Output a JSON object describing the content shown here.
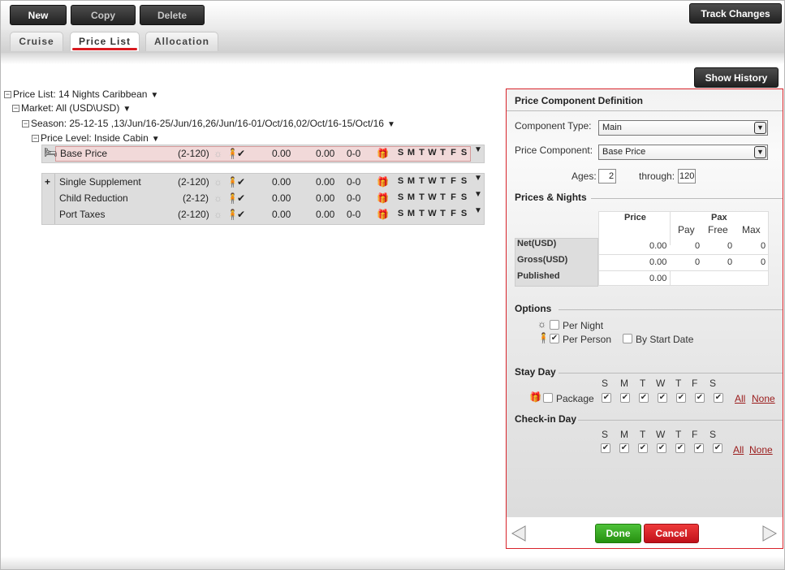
{
  "toolbar": {
    "new": "New",
    "copy": "Copy",
    "delete": "Delete",
    "track": "Track Changes"
  },
  "tabs": [
    "Cruise",
    "Price List",
    "Allocation"
  ],
  "show_history": "Show History",
  "tree": {
    "price_list": "Price List: 14 Nights Caribbean",
    "market": "Market: All (USD\\USD)",
    "season": "Season: 25-12-15 ,13/Jun/16-25/Jun/16,26/Jun/16-01/Oct/16,02/Oct/16-15/Oct/16",
    "price_level": "Price Level: Inside Cabin"
  },
  "base_row": {
    "name": "Base Price",
    "ages": "(2-120)",
    "v1": "0.00",
    "v2": "0.00",
    "v3": "0-0"
  },
  "rows": [
    {
      "name": "Single Supplement",
      "ages": "(2-120)",
      "v1": "0.00",
      "v2": "0.00",
      "v3": "0-0"
    },
    {
      "name": "Child Reduction",
      "ages": "(2-12)",
      "v1": "0.00",
      "v2": "0.00",
      "v3": "0-0"
    },
    {
      "name": "Port Taxes",
      "ages": "(2-120)",
      "v1": "0.00",
      "v2": "0.00",
      "v3": "0-0"
    }
  ],
  "day_letters": [
    "S",
    "M",
    "T",
    "W",
    "T",
    "F",
    "S"
  ],
  "panel": {
    "title": "Price Component Definition",
    "component_type_label": "Component Type:",
    "component_type_value": "Main",
    "price_component_label": "Price Component:",
    "price_component_value": "Base Price",
    "ages_label": "Ages:",
    "ages_from": "2",
    "through_label": "through:",
    "ages_to": "120",
    "prices_nights": "Prices & Nights",
    "col_price": "Price",
    "col_pax": "Pax",
    "col_pay": "Pay",
    "col_free": "Free",
    "col_max": "Max",
    "net_label": "Net(USD)",
    "net": {
      "price": "0.00",
      "pay": "0",
      "free": "0",
      "max": "0"
    },
    "gross_label": "Gross(USD)",
    "gross": {
      "price": "0.00",
      "pay": "0",
      "free": "0",
      "max": "0"
    },
    "published_label": "Published",
    "published": "0.00",
    "options": "Options",
    "per_night": "Per Night",
    "per_person": "Per Person",
    "by_start_date": "By Start Date",
    "stay_day": "Stay Day",
    "package": "Package",
    "all": "All",
    "none": "None",
    "checkin_day": "Check-in Day",
    "done": "Done",
    "cancel": "Cancel"
  }
}
